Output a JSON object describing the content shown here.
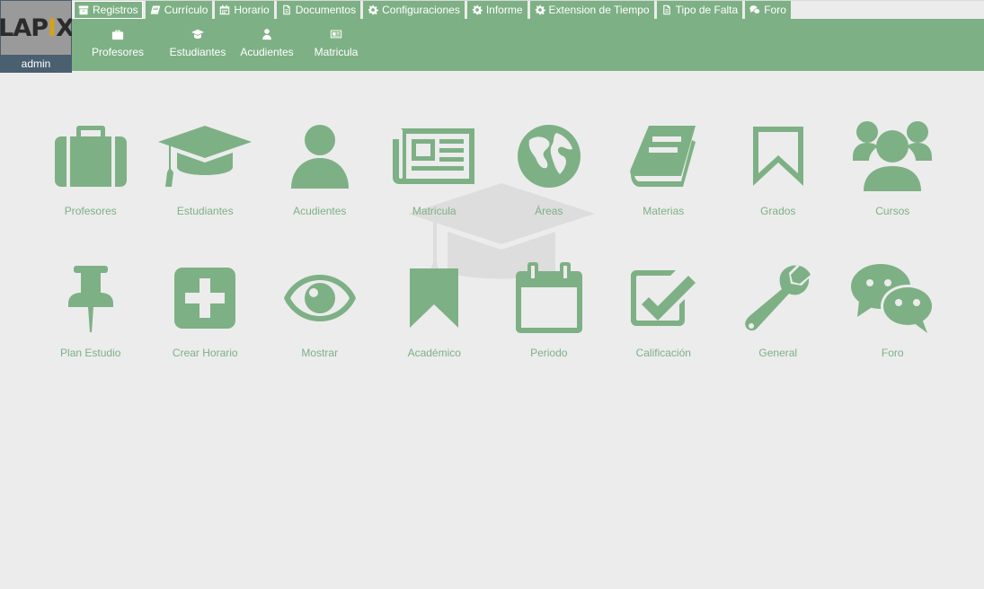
{
  "logo": {
    "text_left": "LAP",
    "text_mark": "I",
    "text_right": "X"
  },
  "user": {
    "name": "admin"
  },
  "tabs": [
    {
      "label": "Registros",
      "icon": "archive-icon"
    },
    {
      "label": "Currículo",
      "icon": "book-icon"
    },
    {
      "label": "Horario",
      "icon": "calendar-icon"
    },
    {
      "label": "Documentos",
      "icon": "document-icon"
    },
    {
      "label": "Configuraciones",
      "icon": "gear-icon"
    },
    {
      "label": "Informe",
      "icon": "gear-icon"
    },
    {
      "label": "Extension de Tiempo",
      "icon": "gear-icon"
    },
    {
      "label": "Tipo de Falta",
      "icon": "document-icon"
    },
    {
      "label": "Foro",
      "icon": "chat-icon"
    }
  ],
  "subnav": [
    {
      "label": "Profesores",
      "icon": "briefcase-icon"
    },
    {
      "label": "Estudiantes",
      "icon": "graduation-cap-icon"
    },
    {
      "label": "Acudientes",
      "icon": "user-icon"
    },
    {
      "label": "Matricula",
      "icon": "newspaper-icon"
    }
  ],
  "grid": [
    {
      "label": "Profesores",
      "icon": "briefcase-icon"
    },
    {
      "label": "Estudiantes",
      "icon": "graduation-cap-icon"
    },
    {
      "label": "Acudientes",
      "icon": "user-icon"
    },
    {
      "label": "Matricula",
      "icon": "newspaper-icon"
    },
    {
      "label": "Áreas",
      "icon": "globe-icon"
    },
    {
      "label": "Materias",
      "icon": "book-icon"
    },
    {
      "label": "Grados",
      "icon": "bookmark-outline-icon"
    },
    {
      "label": "Cursos",
      "icon": "users-icon"
    },
    {
      "label": "Plan Estudio",
      "icon": "pushpin-icon"
    },
    {
      "label": "Crear Horario",
      "icon": "plus-square-icon"
    },
    {
      "label": "Mostrar",
      "icon": "eye-icon"
    },
    {
      "label": "Académico",
      "icon": "bookmark-icon"
    },
    {
      "label": "Periodo",
      "icon": "calendar-icon"
    },
    {
      "label": "Calificación",
      "icon": "check-square-icon"
    },
    {
      "label": "General",
      "icon": "wrench-icon"
    },
    {
      "label": "Foro",
      "icon": "chat-icon"
    }
  ],
  "colors": {
    "accent": "#7eb085",
    "background": "#ececec",
    "logo_panel": "#4a5f70"
  }
}
